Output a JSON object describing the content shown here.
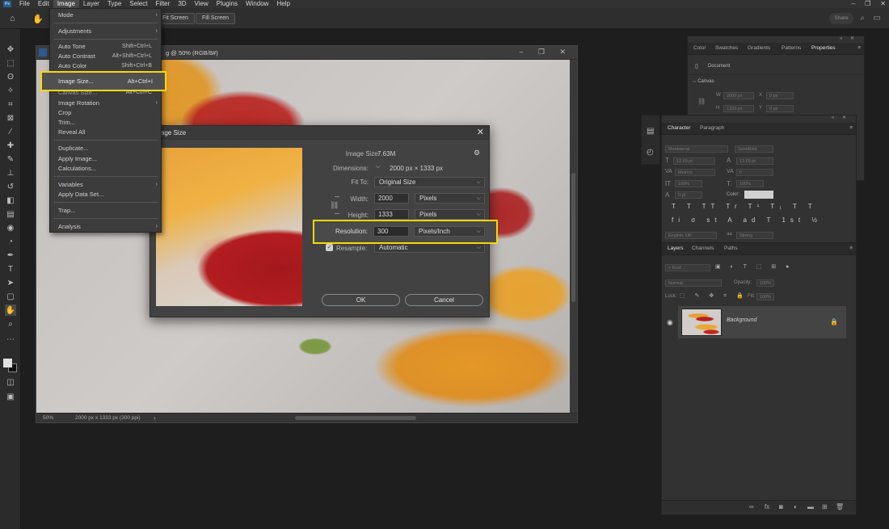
{
  "menubar": {
    "items": [
      "File",
      "Edit",
      "Image",
      "Layer",
      "Type",
      "Select",
      "Filter",
      "3D",
      "View",
      "Plugins",
      "Window",
      "Help"
    ],
    "active": "Image",
    "logo": "Ps"
  },
  "optionsbar": {
    "fit_screen": "Fit Screen",
    "fill_screen": "Fill Screen",
    "share": "Share"
  },
  "document": {
    "tab_title": "g @ 50% (RGB/8#)",
    "status_zoom": "50%",
    "status_dims": "2000 px x 1333 px (300 ppi)"
  },
  "image_menu": {
    "items": [
      {
        "label": "Mode",
        "submenu": true
      },
      {
        "label": "Adjustments",
        "submenu": true
      },
      {
        "label": "Auto Tone",
        "shortcut": "Shift+Ctrl+L"
      },
      {
        "label": "Auto Contrast",
        "shortcut": "Alt+Shift+Ctrl+L"
      },
      {
        "label": "Auto Color",
        "shortcut": "Shift+Ctrl+B"
      },
      {
        "label": "Image Size...",
        "shortcut": "Alt+Ctrl+I",
        "highlighted": true
      },
      {
        "label": "Canvas Size...",
        "shortcut": "Alt+Ctrl+C"
      },
      {
        "label": "Image Rotation",
        "submenu": true
      },
      {
        "label": "Crop"
      },
      {
        "label": "Trim..."
      },
      {
        "label": "Reveal All"
      },
      {
        "label": "Duplicate..."
      },
      {
        "label": "Apply Image..."
      },
      {
        "label": "Calculations..."
      },
      {
        "label": "Variables",
        "submenu": true
      },
      {
        "label": "Apply Data Set..."
      },
      {
        "label": "Trap..."
      },
      {
        "label": "Analysis",
        "submenu": true
      }
    ]
  },
  "dialog": {
    "title": "Image Size",
    "image_size_label": "Image Size:",
    "image_size_value": "7.63M",
    "dimensions_label": "Dimensions:",
    "dimensions_value": "2000 px  ×  1333 px",
    "fit_to_label": "Fit To:",
    "fit_to_value": "Original Size",
    "width_label": "Width:",
    "width_value": "2000",
    "width_unit": "Pixels",
    "height_label": "Height:",
    "height_value": "1333",
    "height_unit": "Pixels",
    "resolution_label": "Resolution:",
    "resolution_value": "300",
    "resolution_unit": "Pixels/Inch",
    "resample_label": "Resample:",
    "resample_value": "Automatic",
    "ok": "OK",
    "cancel": "Cancel"
  },
  "properties_panel": {
    "tabs": [
      "Color",
      "Swatches",
      "Gradients",
      "Patterns",
      "Properties"
    ],
    "active_tab": "Properties",
    "document_label": "Document",
    "canvas_label": "Canvas",
    "w_label": "W",
    "h_label": "H",
    "x_label": "X",
    "y_label": "Y",
    "w_value": "2000 px",
    "h_value": "1333 px",
    "x_value": "0 px",
    "y_value": "0 px"
  },
  "character_panel": {
    "tabs": [
      "Character",
      "Paragraph"
    ],
    "active_tab": "Character",
    "font_family": "Montserrat",
    "font_style": "SemiBold",
    "font_size": "13.69 pt",
    "leading": "13.69 pt",
    "kerning": "Metrics",
    "tracking": "0",
    "vertical_scale": "100%",
    "horizontal_scale": "100%",
    "baseline_shift": "0 pt",
    "color_label": "Color:",
    "language": "English: UK",
    "antialias": "Strong"
  },
  "layers_panel": {
    "tabs": [
      "Layers",
      "Channels",
      "Paths"
    ],
    "active_tab": "Layers",
    "kind": "Kind",
    "blend_mode": "Normal",
    "opacity_label": "Opacity:",
    "opacity_value": "100%",
    "lock_label": "Lock:",
    "fill_label": "Fill:",
    "fill_value": "100%",
    "layer_name": "Background"
  }
}
